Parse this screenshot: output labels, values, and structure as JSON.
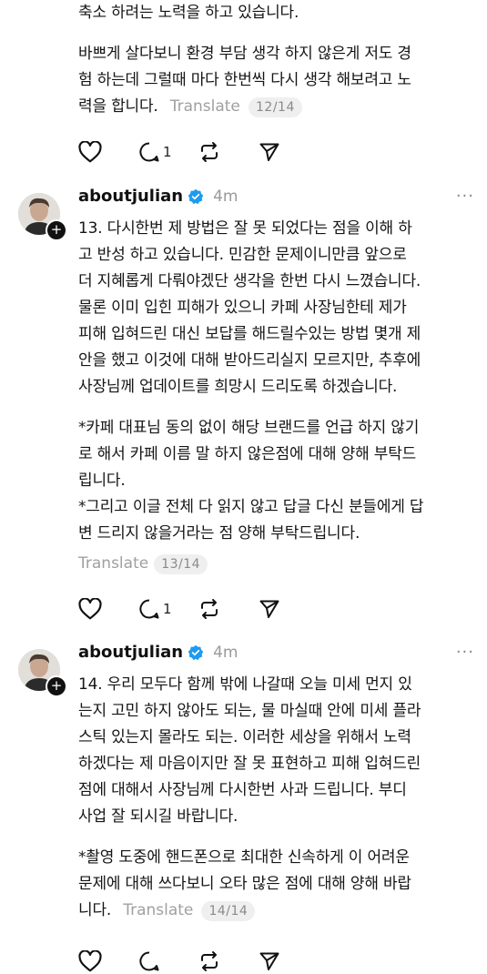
{
  "post12": {
    "paragraphs": [
      "축소 하려는 노력을 하고 있습니다.",
      "바쁘게 살다보니 환경 부담 생각 하지 않은게 저도 경\n험 하는데 그럴때 마다 한번씩 다시 생각 해보려고 노\n력을 합니다."
    ],
    "translate": "Translate",
    "page": "12/14",
    "reply_count": "1"
  },
  "post13": {
    "username": "aboutjulian",
    "time": "4m",
    "more": "···",
    "paragraphs": [
      "13. 다시한번 제 방법은 잘 못 되었다는 점을 이해 하\n고 반성 하고 있습니다. 민감한 문제이니만큼 앞으로\n더 지혜롭게 다뤄야겠단 생각을 한번 다시 느꼈습니다.\n물론 이미 입힌 피해가 있으니 카페 사장님한테 제가\n피해 입혀드린 대신 보답를 해드릴수있는 방법 몇개 제\n안을 했고 이것에 대해 받아드리실지 모르지만, 추후에\n사장님께 업데이트를 희망시 드리도록 하겠습니다.",
      "*카페 대표님 동의 없이 해당 브랜드를 언급 하지 않기\n로 해서 카페 이름 말 하지 않은점에 대해 양해 부탁드\n립니다.\n*그리고 이글 전체 다 읽지 않고 답글 다신 분들에게 답\n변 드리지 않을거라는 점 양해 부탁드립니다."
    ],
    "translate": "Translate",
    "page": "13/14",
    "reply_count": "1"
  },
  "post14": {
    "username": "aboutjulian",
    "time": "4m",
    "more": "···",
    "paragraphs": [
      "14. 우리 모두다 함께 밖에 나갈때 오늘 미세 먼지 있\n는지 고민 하지 않아도 되는, 물 마실때 안에 미세 플라\n스틱 있는지 몰라도 되는. 이러한 세상을 위해서 노력\n하겠다는 제 마음이지만 잘 못 표현하고 피해 입혀드린\n점에 대해서 사장님께 다시한번 사과 드립니다. 부디\n사업 잘 되시길 바랍니다.",
      "*촬영 도중에 핸드폰으로 최대한 신속하게 이 어려운\n문제에 대해 쓰다보니 오타 많은 점에 대해 양해 바랍\n니다."
    ],
    "translate": "Translate",
    "page": "14/14"
  },
  "colors": {
    "verified": "#1d9bf0",
    "muted": "#9a9a9a"
  }
}
